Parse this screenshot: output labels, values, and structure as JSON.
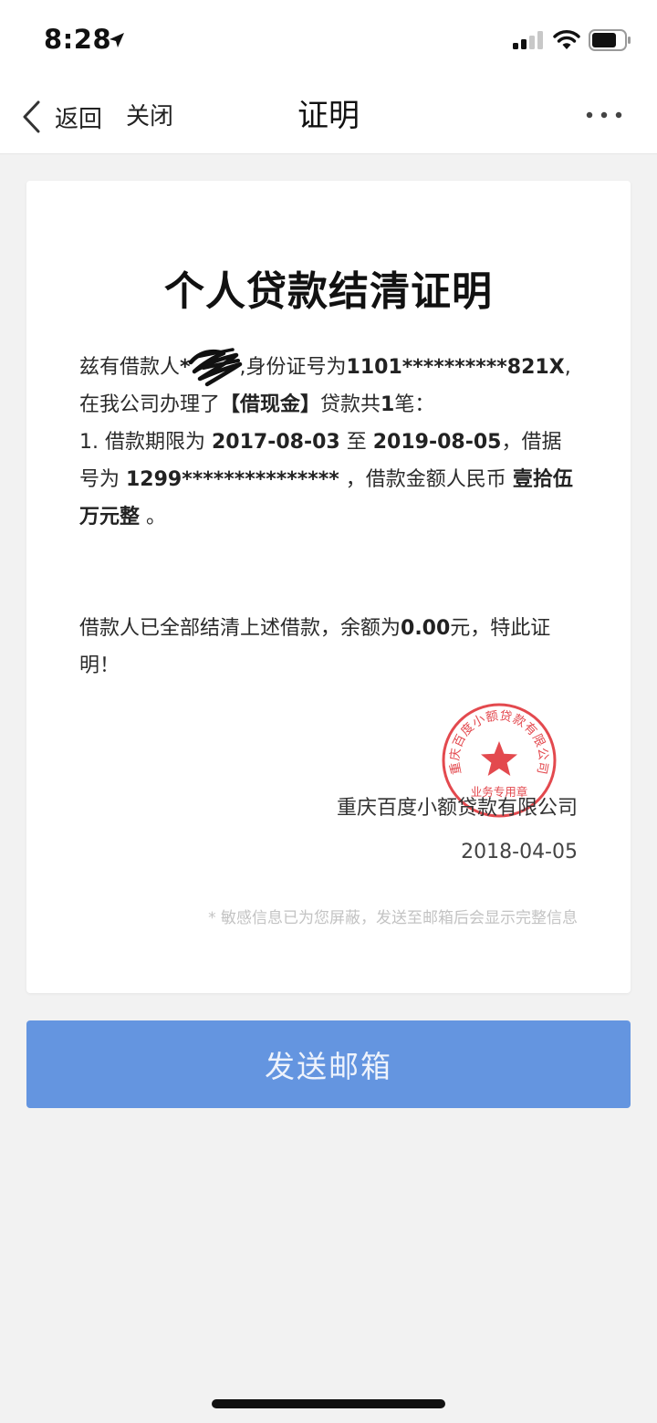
{
  "status_bar": {
    "time": "8:28"
  },
  "nav": {
    "back_label": "返回",
    "close_label": "关闭",
    "title": "证明"
  },
  "document": {
    "title": "个人贷款结清证明",
    "para1": {
      "t1": "兹有借款人",
      "borrower_prefix": "*",
      "t2": ",身份证号为",
      "id_number": "1101**********821X",
      "t3": ", 在我公司办理了",
      "product": "【借现金】",
      "t4": "贷款共",
      "count": "1",
      "t5": "笔：",
      "item_prefix": "1. 借款期限为 ",
      "start_date": "2017-08-03",
      "t6": " 至 ",
      "end_date": "2019-08-05",
      "t7": "，借据号为 ",
      "receipt_no": "1299***************",
      "t8": " ，借款金额人民币 ",
      "amount": "壹拾伍万元整",
      "t9": " 。"
    },
    "para2": {
      "t1": "借款人已全部结清上述借款，余额为",
      "balance": "0.00",
      "t2": "元，特此证明！"
    },
    "seal": {
      "company_arc": "重庆百度小额贷款有限公司",
      "bottom_text": "业务专用章",
      "color": "#e0353b"
    },
    "company": "重庆百度小额贷款有限公司",
    "date": "2018-04-05",
    "notice": "* 敏感信息已为您屏蔽，发送至邮箱后会显示完整信息"
  },
  "send_button_label": "发送邮箱",
  "colors": {
    "primary_button": "#6495e0",
    "seal_red": "#e0353b"
  }
}
